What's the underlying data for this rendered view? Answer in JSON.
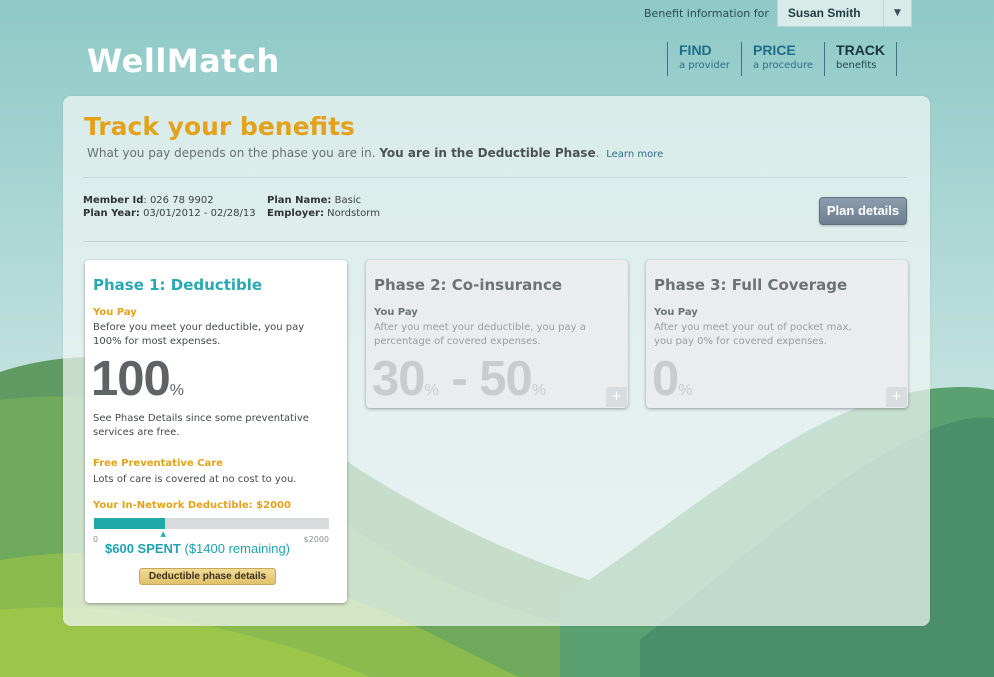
{
  "header": {
    "benefit_label": "Benefit information for",
    "member_select": "Susan Smith",
    "logo": "WellMatch",
    "nav": [
      {
        "title": "FIND",
        "sub": "a provider"
      },
      {
        "title": "PRICE",
        "sub": "a procedure"
      },
      {
        "title": "TRACK",
        "sub": "benefits"
      }
    ]
  },
  "page": {
    "title": "Track your benefits",
    "subtitle_prefix": "What you pay depends on the phase you are in.",
    "subtitle_bold": "You are in the Deductible Phase",
    "subtitle_end": ".",
    "learn_more": "Learn more"
  },
  "member": {
    "id_label": "Member Id",
    "id_value": ": 026 78 9902",
    "plan_name_label": "Plan Name:",
    "plan_name_value": " Basic",
    "plan_year_label": "Plan Year:",
    "plan_year_value": " 03/01/2012 - 02/28/13",
    "employer_label": "Employer:",
    "employer_value": " Nordstorm",
    "plan_details_button": "Plan details"
  },
  "phases": [
    {
      "title": "Phase 1: Deductible",
      "you_pay_label": "You Pay",
      "description_line1": "Before you meet your deductible, you pay",
      "description_line2": "100% for most expenses.",
      "amount": "100",
      "amount_unit": "%",
      "note_line1": "See Phase Details since some preventative",
      "note_line2": "services are free.",
      "free_care_label": "Free Preventative Care",
      "free_care_text": "Lots of care is covered at no cost to you.",
      "deductible_label": "Your In-Network Deductible: $2000",
      "progress_fraction": 0.3,
      "range_min": "0",
      "range_max": "$2000",
      "spent": "$600 SPENT",
      "remaining": "($1400 remaining)",
      "details_button": "Deductible phase details"
    },
    {
      "title": "Phase 2: Co-insurance",
      "you_pay_label": "You Pay",
      "description_line1": "After you meet your deductible, you pay a",
      "description_line2": "percentage of covered expenses.",
      "amount_low": "30",
      "amount_high": "50",
      "amount_unit": "%",
      "amount_sep": " - ",
      "expand": "+"
    },
    {
      "title": "Phase 3: Full Coverage",
      "you_pay_label": "You Pay",
      "description_line1": "After you meet your out of pocket max,",
      "description_line2": "you pay 0% for covered expenses.",
      "amount": "0",
      "amount_unit": "%",
      "expand": "+"
    }
  ],
  "colors": {
    "accent_orange": "#e3a21a",
    "accent_teal": "#27a9b2",
    "progress": "#1eaaa8"
  }
}
